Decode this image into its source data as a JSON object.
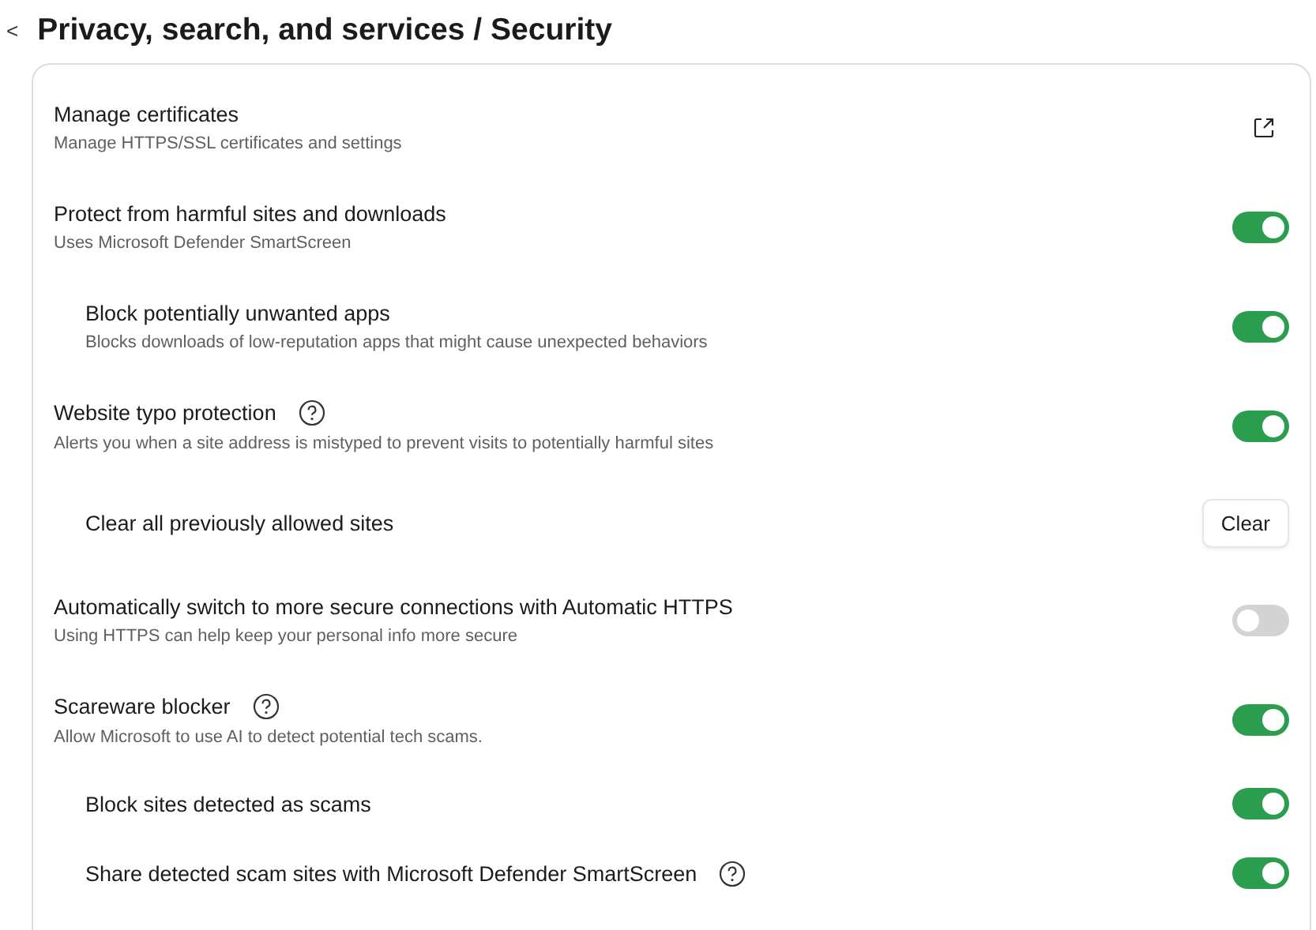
{
  "header": {
    "back": "<",
    "title": "Privacy, search, and services / Security"
  },
  "settings": [
    {
      "kind": "link",
      "title": "Manage certificates",
      "description": "Manage HTTPS/SSL certificates and settings"
    },
    {
      "kind": "toggle",
      "title": "Protect from harmful sites and downloads",
      "description": "Uses Microsoft Defender SmartScreen",
      "on": true,
      "children": [
        {
          "kind": "toggle",
          "title": "Block potentially unwanted apps",
          "description": "Blocks downloads of low-reputation apps that might cause unexpected behaviors",
          "on": true
        }
      ]
    },
    {
      "kind": "toggle",
      "title": "Website typo protection",
      "help": true,
      "description": "Alerts you when a site address is mistyped to prevent visits to potentially harmful sites",
      "on": true,
      "children": [
        {
          "kind": "button",
          "title": "Clear all previously allowed sites",
          "button": "Clear"
        }
      ]
    },
    {
      "kind": "toggle",
      "title": "Automatically switch to more secure connections with Automatic HTTPS",
      "description": "Using HTTPS can help keep your personal info more secure",
      "on": false
    },
    {
      "kind": "toggle",
      "title": "Scareware blocker",
      "help": true,
      "description": "Allow Microsoft to use AI to detect potential tech scams.",
      "on": true,
      "children": [
        {
          "kind": "toggle",
          "title": "Block sites detected as scams",
          "on": true
        },
        {
          "kind": "toggle",
          "title": "Share detected scam sites with Microsoft Defender SmartScreen",
          "help": true,
          "on": true
        }
      ]
    }
  ]
}
